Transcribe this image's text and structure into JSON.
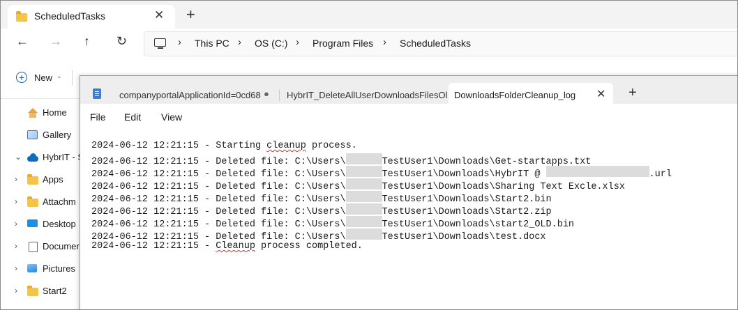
{
  "explorer": {
    "tab_title": "ScheduledTasks",
    "new_tab_glyph": "+",
    "close_glyph": "✕",
    "nav": {
      "back": "←",
      "forward": "→",
      "up": "↑",
      "refresh": "↻"
    },
    "breadcrumbs": [
      "This PC",
      "OS (C:)",
      "Program Files",
      "ScheduledTasks"
    ],
    "chevron_glyph": "›",
    "toolbar": {
      "new_label": "New",
      "new_plus": "+",
      "caret": "⌄"
    },
    "sidebar": {
      "items": [
        {
          "label": "Home",
          "icon": "home-icon"
        },
        {
          "label": "Gallery",
          "icon": "gallery-icon"
        },
        {
          "label": "HybrIT - Sr",
          "icon": "cloud-icon"
        },
        {
          "label": "Apps",
          "icon": "folder-icon"
        },
        {
          "label": "Attachm",
          "icon": "folder-icon"
        },
        {
          "label": "Desktop",
          "icon": "desktop-icon"
        },
        {
          "label": "Documer",
          "icon": "documents-icon"
        },
        {
          "label": "Pictures",
          "icon": "pictures-icon"
        },
        {
          "label": "Start2",
          "icon": "folder-icon"
        }
      ],
      "expand_glyph": "›",
      "expanded_glyph": "⌄"
    }
  },
  "notepad": {
    "tabs": [
      {
        "label": "companyportalApplicationId=0cd68",
        "modified_dot": "●"
      },
      {
        "label": "HybrIT_DeleteAllUserDownloadsFilesOlder"
      },
      {
        "label": "DownloadsFolderCleanup_log",
        "active": true
      }
    ],
    "close_glyph": "✕",
    "new_tab_glyph": "+",
    "menu": [
      "File",
      "Edit",
      "View"
    ],
    "log": {
      "prefix": "2024-06-12 12:21:15 - ",
      "start_pre": "Starting ",
      "start_word": "cleanup",
      "start_post": " process.",
      "deleted_pre": "Deleted file: C:\\Users\\",
      "deleted_files": [
        "TestUser1\\Downloads\\Get-startapps.txt",
        "TestUser1\\Downloads\\HybrIT @ ",
        "TestUser1\\Downloads\\Sharing Text Excle.xlsx",
        "TestUser1\\Downloads\\Start2.bin",
        "TestUser1\\Downloads\\Start2.zip",
        "TestUser1\\Downloads\\start2_OLD.bin",
        "TestUser1\\Downloads\\test.docx"
      ],
      "url_suffix": ".url",
      "end_word": "Cleanup",
      "end_post": " process completed."
    }
  }
}
